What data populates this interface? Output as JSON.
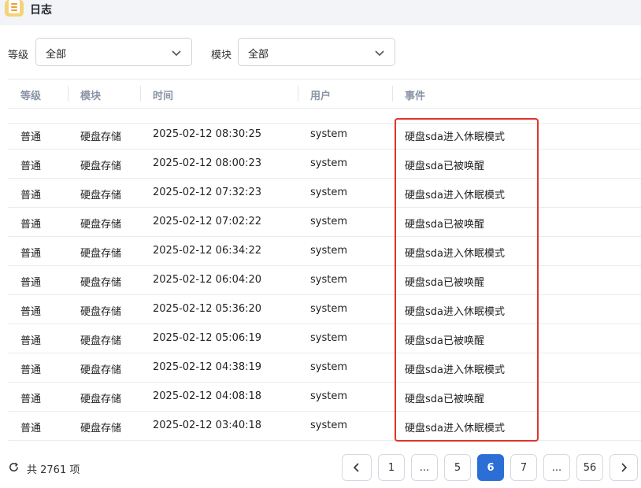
{
  "window": {
    "title": "日志",
    "icon": "log-app-icon"
  },
  "filters": {
    "level": {
      "label": "等级",
      "value": "全部"
    },
    "module": {
      "label": "模块",
      "value": "全部"
    }
  },
  "table": {
    "headers": [
      "等级",
      "模块",
      "时间",
      "用户",
      "事件"
    ],
    "rows": [
      [
        "普通",
        "硬盘存储",
        "2025-02-12 08:30:25",
        "system",
        "硬盘sda进入休眠模式"
      ],
      [
        "普通",
        "硬盘存储",
        "2025-02-12 08:00:23",
        "system",
        "硬盘sda已被唤醒"
      ],
      [
        "普通",
        "硬盘存储",
        "2025-02-12 07:32:23",
        "system",
        "硬盘sda进入休眠模式"
      ],
      [
        "普通",
        "硬盘存储",
        "2025-02-12 07:02:22",
        "system",
        "硬盘sda已被唤醒"
      ],
      [
        "普通",
        "硬盘存储",
        "2025-02-12 06:34:22",
        "system",
        "硬盘sda进入休眠模式"
      ],
      [
        "普通",
        "硬盘存储",
        "2025-02-12 06:04:20",
        "system",
        "硬盘sda已被唤醒"
      ],
      [
        "普通",
        "硬盘存储",
        "2025-02-12 05:36:20",
        "system",
        "硬盘sda进入休眠模式"
      ],
      [
        "普通",
        "硬盘存储",
        "2025-02-12 05:06:19",
        "system",
        "硬盘sda已被唤醒"
      ],
      [
        "普通",
        "硬盘存储",
        "2025-02-12 04:38:19",
        "system",
        "硬盘sda进入休眠模式"
      ],
      [
        "普通",
        "硬盘存储",
        "2025-02-12 04:08:18",
        "system",
        "硬盘sda已被唤醒"
      ],
      [
        "普通",
        "硬盘存储",
        "2025-02-12 03:40:18",
        "system",
        "硬盘sda进入休眠模式"
      ]
    ]
  },
  "footer": {
    "total": "共 2761 项",
    "pages": [
      "1",
      "...",
      "5",
      "6",
      "7",
      "...",
      "56"
    ],
    "current_page": "6"
  },
  "colors": {
    "accent": "#2b6fd6",
    "highlight": "#e0342b",
    "header_text": "#8a94a6"
  }
}
